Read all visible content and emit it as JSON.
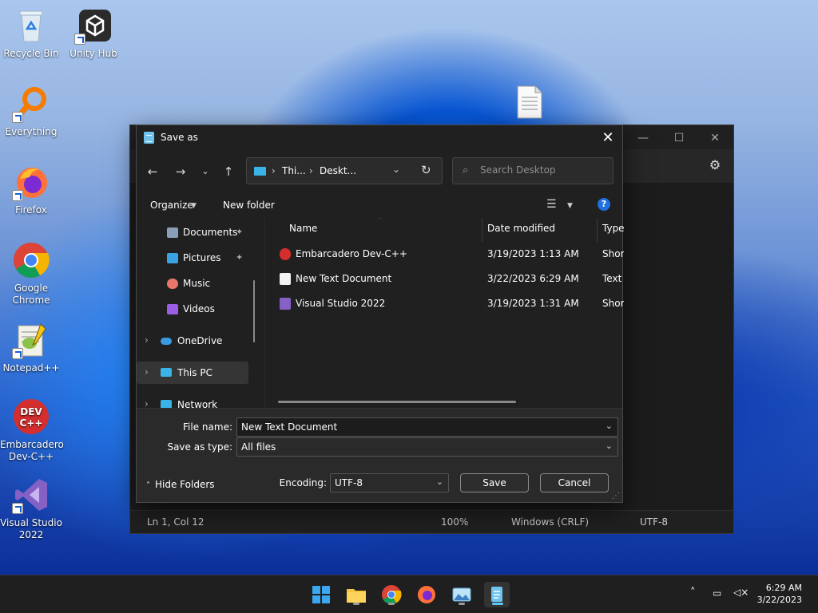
{
  "desktop": {
    "icons": [
      {
        "label": "Recycle Bin"
      },
      {
        "label": "Unity Hub"
      },
      {
        "label": "Everything"
      },
      {
        "label": "Firefox"
      },
      {
        "label": "Google Chrome"
      },
      {
        "label": "Notepad++"
      },
      {
        "label": "Embarcadero Dev-C++"
      },
      {
        "label": "Visual Studio 2022"
      }
    ]
  },
  "notepad": {
    "status": {
      "position": "Ln 1, Col 12",
      "zoom": "100%",
      "line_ending": "Windows (CRLF)",
      "encoding": "UTF-8"
    }
  },
  "dialog": {
    "title": "Save as",
    "address": {
      "seg1": "Thi...",
      "seg2": "Deskt..."
    },
    "search_placeholder": "Search Desktop",
    "commands": {
      "organize": "Organize",
      "new_folder": "New folder"
    },
    "nav_items": [
      {
        "label": "Documents"
      },
      {
        "label": "Pictures"
      },
      {
        "label": "Music"
      },
      {
        "label": "Videos"
      },
      {
        "label": "OneDrive"
      },
      {
        "label": "This PC"
      },
      {
        "label": "Network"
      }
    ],
    "columns": {
      "name": "Name",
      "date": "Date modified",
      "type": "Type"
    },
    "files": [
      {
        "name": "Embarcadero Dev-C++",
        "date": "3/19/2023 1:13 AM",
        "type": "Short"
      },
      {
        "name": "New Text Document",
        "date": "3/22/2023 6:29 AM",
        "type": "Text D"
      },
      {
        "name": "Visual Studio 2022",
        "date": "3/19/2023 1:31 AM",
        "type": "Short"
      }
    ],
    "file_name_label": "File name:",
    "file_name_value": "New Text Document",
    "save_type_label": "Save as type:",
    "save_type_value": "All files",
    "hide_folders": "Hide Folders",
    "encoding_label": "Encoding:",
    "encoding_value": "UTF-8",
    "save_button": "Save",
    "cancel_button": "Cancel"
  },
  "taskbar": {
    "apps": [
      "windows-start",
      "file-explorer",
      "chrome",
      "firefox",
      "photos",
      "notepad"
    ],
    "time": "6:29 AM",
    "date": "3/22/2023"
  }
}
